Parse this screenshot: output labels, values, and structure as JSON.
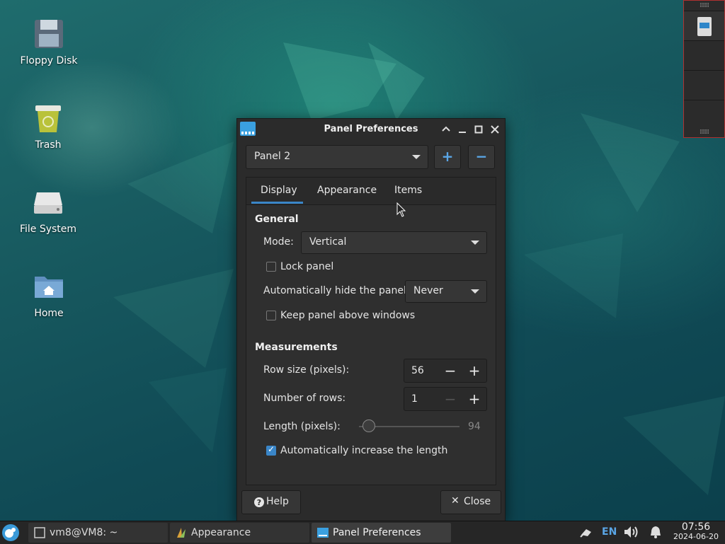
{
  "desktop": {
    "icons": [
      {
        "label": "Floppy Disk"
      },
      {
        "label": "Trash"
      },
      {
        "label": "File System"
      },
      {
        "label": "Home"
      }
    ]
  },
  "dialog": {
    "title": "Panel Preferences",
    "panel_selector": "Panel 2",
    "add_label": "+",
    "remove_label": "−",
    "tabs": [
      "Display",
      "Appearance",
      "Items"
    ],
    "active_tab": "Display",
    "general": {
      "heading": "General",
      "mode_label": "Mode:",
      "mode_value": "Vertical",
      "lock_panel_label": "Lock panel",
      "lock_panel_checked": false,
      "autohide_label": "Automatically hide the panel:",
      "autohide_value": "Never",
      "keep_above_label": "Keep panel above windows",
      "keep_above_checked": false
    },
    "measurements": {
      "heading": "Measurements",
      "row_size_label": "Row size (pixels):",
      "row_size_value": "56",
      "rows_label": "Number of rows:",
      "rows_value": "1",
      "length_label": "Length (pixels):",
      "length_value": "94",
      "auto_increase_label": "Automatically increase the length",
      "auto_increase_checked": true
    },
    "help_label": "Help",
    "close_label": "Close"
  },
  "taskbar": {
    "tasks": [
      {
        "label": "vm8@VM8: ~"
      },
      {
        "label": "Appearance"
      },
      {
        "label": "Panel Preferences"
      }
    ],
    "keyboard_layout": "EN",
    "time": "07:56",
    "date": "2024-06-20"
  },
  "colors": {
    "accent": "#3a86c8",
    "dialog_bg": "#2b2b2b",
    "taskbar_bg": "#262626"
  }
}
